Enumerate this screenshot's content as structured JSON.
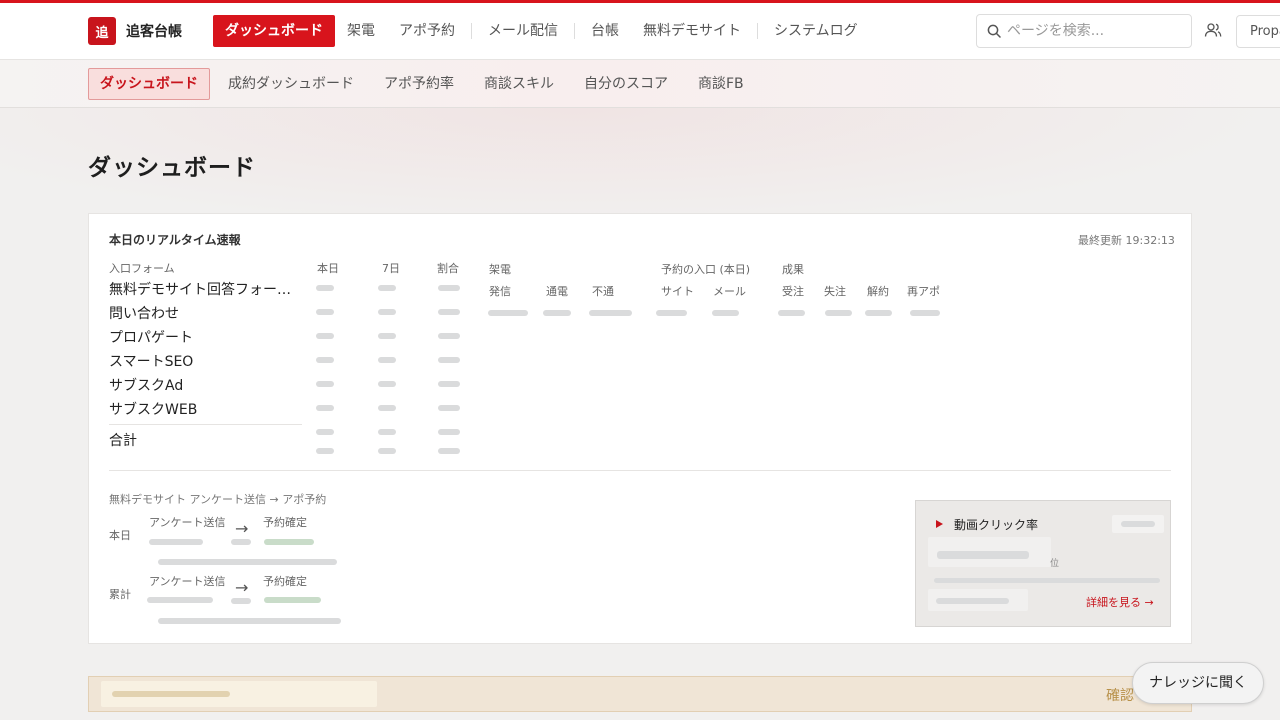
{
  "header": {
    "logo_mark": "追",
    "logo_text": "追客台帳",
    "nav": [
      "ダッシュボード",
      "架電",
      "アポ予約",
      "メール配信",
      "台帳",
      "無料デモサイト",
      "システムログ"
    ],
    "search_placeholder": "ページを検索...",
    "prop_label": "Propa"
  },
  "subnav": [
    "ダッシュボード",
    "成約ダッシュボード",
    "アポ予約率",
    "商談スキル",
    "自分のスコア",
    "商談FB"
  ],
  "page_title": "ダッシュボード",
  "realtime": {
    "title": "本日のリアルタイム速報",
    "last_updated": "最終更新 19:32:13",
    "col_form": "入口フォーム",
    "col_today": "本日",
    "col_7d": "7日",
    "col_ratio": "割合",
    "sources": [
      "無料デモサイト回答フォー…",
      "問い合わせ",
      "プロパゲート",
      "スマートSEO",
      "サブスクAd",
      "サブスクWEB"
    ],
    "total_label": "合計",
    "call_group": "架電",
    "call_cols": [
      "発信",
      "通電",
      "不通"
    ],
    "entry_group": "予約の入口 (本日)",
    "entry_cols": [
      "サイト",
      "メール"
    ],
    "result_group": "成果",
    "result_cols": [
      "受注",
      "失注",
      "解約",
      "再アポ"
    ]
  },
  "funnel": {
    "title": "無料デモサイト アンケート送信 → アポ予約",
    "rows": [
      {
        "label": "本日",
        "from": "アンケート送信",
        "to": "予約確定"
      },
      {
        "label": "累計",
        "from": "アンケート送信",
        "to": "予約確定"
      }
    ],
    "arrow": "→"
  },
  "video": {
    "title": "動画クリック率",
    "unit": "位",
    "detail_link": "詳細を見る →"
  },
  "banner_link": "確認",
  "knowledge_button": "ナレッジに聞く"
}
